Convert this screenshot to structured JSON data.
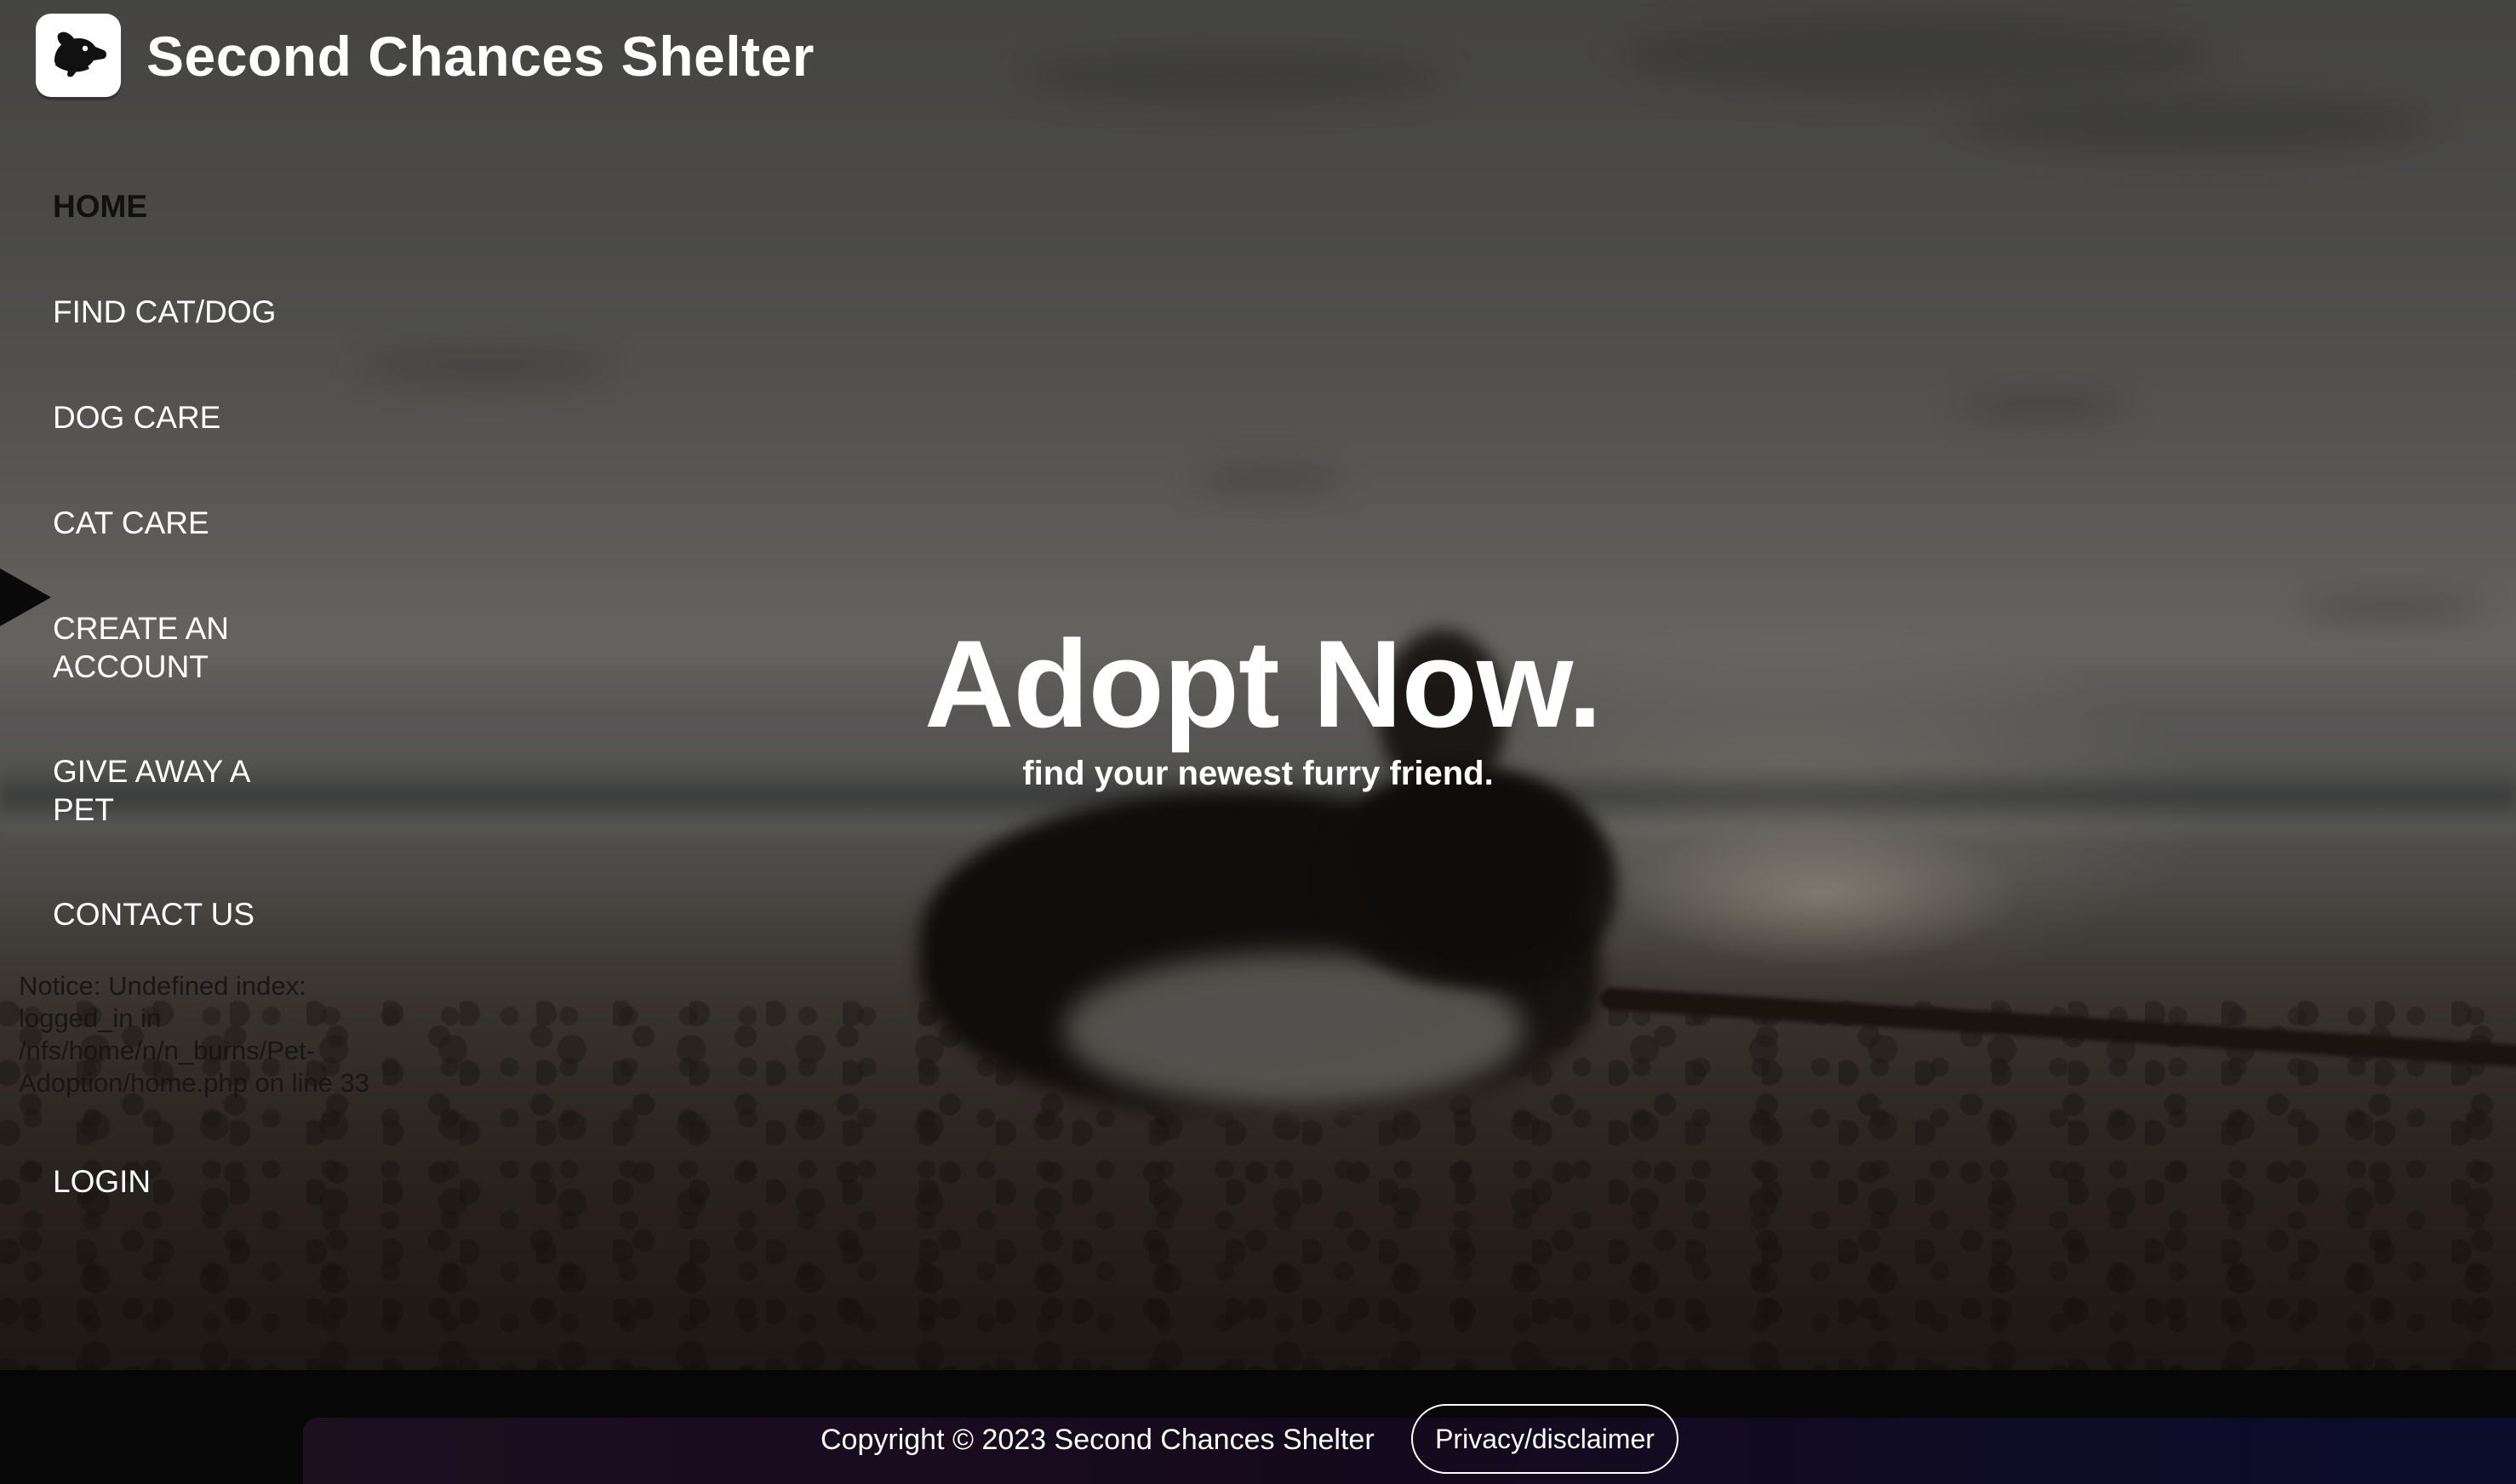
{
  "header": {
    "logo_icon": "dog-head-icon",
    "title": "Second Chances Shelter"
  },
  "nav": {
    "items": [
      {
        "label": "HOME",
        "active": true
      },
      {
        "label": "FIND CAT/DOG",
        "active": false
      },
      {
        "label": "DOG CARE",
        "active": false
      },
      {
        "label": "CAT CARE",
        "active": false
      },
      {
        "label": "CREATE AN ACCOUNT",
        "active": false
      },
      {
        "label": "GIVE AWAY A PET",
        "active": false
      },
      {
        "label": "CONTACT US",
        "active": false
      },
      {
        "label": "LOGIN",
        "active": false
      }
    ],
    "notice": "Notice: Undefined index: logged_in in /nfs/home/n/n_burns/Pet-Adoption/home.php on line 33"
  },
  "hero": {
    "title": "Adopt Now.",
    "subtitle": "find your newest furry friend."
  },
  "footer": {
    "copyright": "Copyright © 2023 Second Chances Shelter",
    "privacy_label": "Privacy/disclaimer"
  },
  "colors": {
    "active_nav": "#111111",
    "footer_gradient_start": "#1d0e20",
    "footer_gradient_end": "#0b0d2c"
  }
}
